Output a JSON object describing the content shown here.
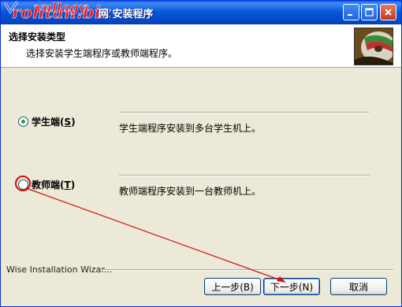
{
  "window": {
    "title": "网 安装程序",
    "watermark": "rohtan.biz",
    "watermark_script": "vullagy"
  },
  "header": {
    "title": "选择安装类型",
    "subtitle": "选择安装学生端程序或教师端程序。"
  },
  "options": [
    {
      "label": "学生端(",
      "accel": "S",
      "label_end": ")",
      "description": "学生端程序安装到多台学生机上。",
      "checked": true
    },
    {
      "label": "教师端(",
      "accel": "T",
      "label_end": ")",
      "description": "教师端程序安装到一台教师机上。",
      "checked": false
    }
  ],
  "footer": {
    "label": "Wise Installation Wizar...",
    "back_label": "上一步(B)",
    "next_label": "下一步(N)",
    "cancel_label": "取消"
  },
  "colors": {
    "titlebar": "#0a58da",
    "annotation": "#d01010",
    "radio_dot": "#21a121"
  }
}
